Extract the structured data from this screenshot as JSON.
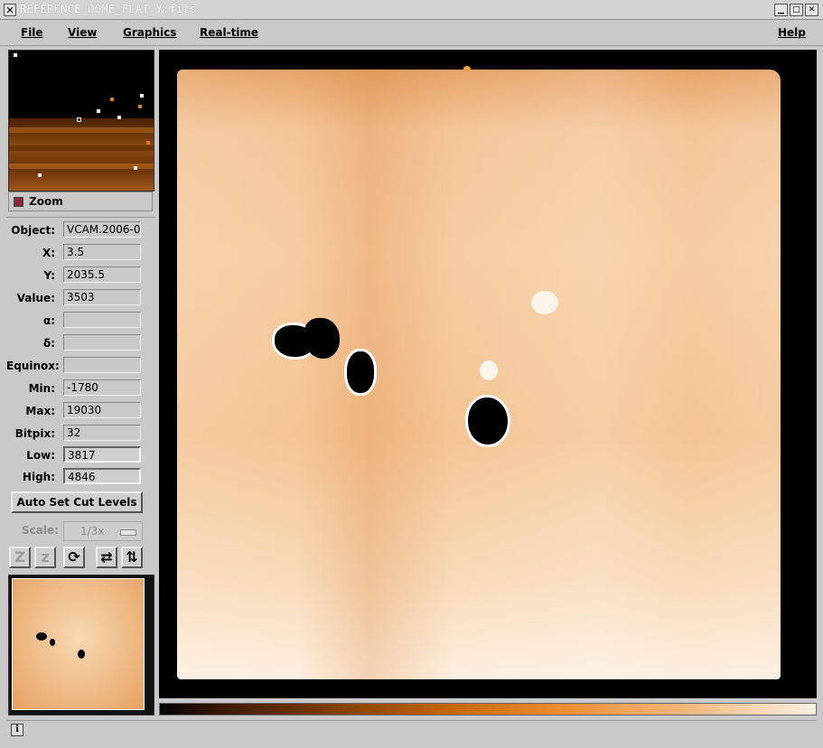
{
  "window": {
    "title": "REFERENCE_DOME_FLAT_Y.fits"
  },
  "menu": {
    "file": "File",
    "view": "View",
    "graphics": "Graphics",
    "realtime": "Real-time",
    "help": "Help"
  },
  "zoom": {
    "label": "Zoom"
  },
  "info": {
    "object_label": "Object:",
    "object_value": "VCAM.2006-0",
    "x_label": "X:",
    "x_value": "3.5",
    "y_label": "Y:",
    "y_value": "2035.5",
    "value_label": "Value:",
    "value_value": "3503",
    "alpha_label": "α:",
    "alpha_value": "",
    "delta_label": "δ:",
    "delta_value": "",
    "equinox_label": "Equinox:",
    "equinox_value": "",
    "min_label": "Min:",
    "min_value": "-1780",
    "max_label": "Max:",
    "max_value": "19030",
    "bitpix_label": "Bitpix:",
    "bitpix_value": "32",
    "low_label": "Low:",
    "low_value": "3817",
    "high_label": "High:",
    "high_value": "4846"
  },
  "buttons": {
    "auto_set": "Auto Set Cut Levels"
  },
  "scale": {
    "label": "Scale:",
    "value": "1/3x"
  },
  "colormap": {
    "accent": "#e8862a",
    "dark": "#000000",
    "light": "#fdf0e2"
  }
}
